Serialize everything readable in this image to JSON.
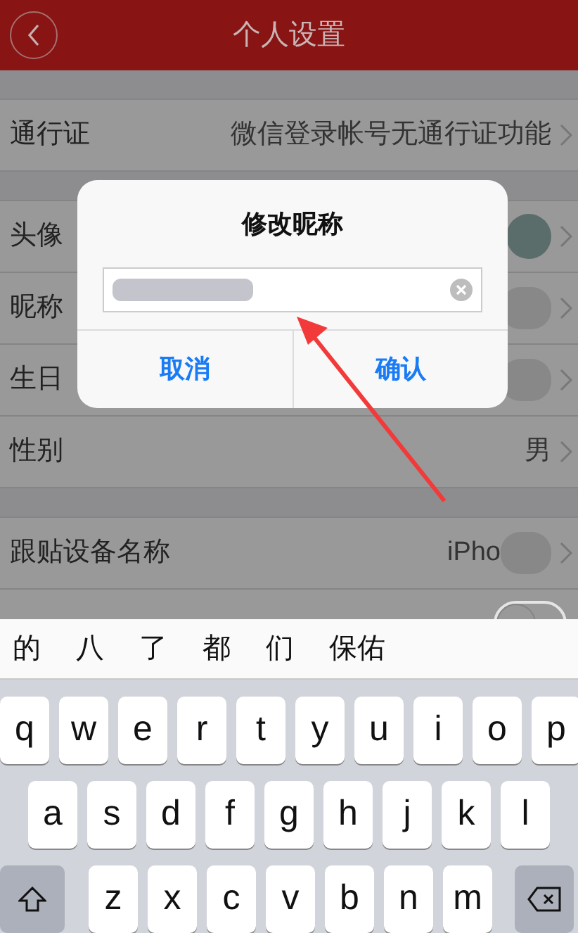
{
  "header": {
    "title": "个人设置"
  },
  "sections": [
    [
      {
        "label": "通行证",
        "value": "微信登录帐号无通行证功能",
        "kind": "text"
      }
    ],
    [
      {
        "label": "头像",
        "kind": "avatar"
      },
      {
        "label": "昵称",
        "kind": "blurred"
      },
      {
        "label": "生日",
        "kind": "blurred"
      },
      {
        "label": "性别",
        "value": "男",
        "kind": "text"
      }
    ],
    [
      {
        "label": "跟贴设备名称",
        "value": "iPho",
        "kind": "blurred"
      },
      {
        "kind": "toggle",
        "on": false
      }
    ]
  ],
  "dialog": {
    "title": "修改昵称",
    "buttons": [
      "取消",
      "确认"
    ]
  },
  "keyboard": {
    "candidates": [
      "的",
      "八",
      "了",
      "都",
      "们",
      "保佑"
    ],
    "rows": [
      [
        "q",
        "w",
        "e",
        "r",
        "t",
        "y",
        "u",
        "i",
        "o",
        "p"
      ],
      [
        "a",
        "s",
        "d",
        "f",
        "g",
        "h",
        "j",
        "k",
        "l"
      ],
      [
        "z",
        "x",
        "c",
        "v",
        "b",
        "n",
        "m"
      ]
    ]
  }
}
